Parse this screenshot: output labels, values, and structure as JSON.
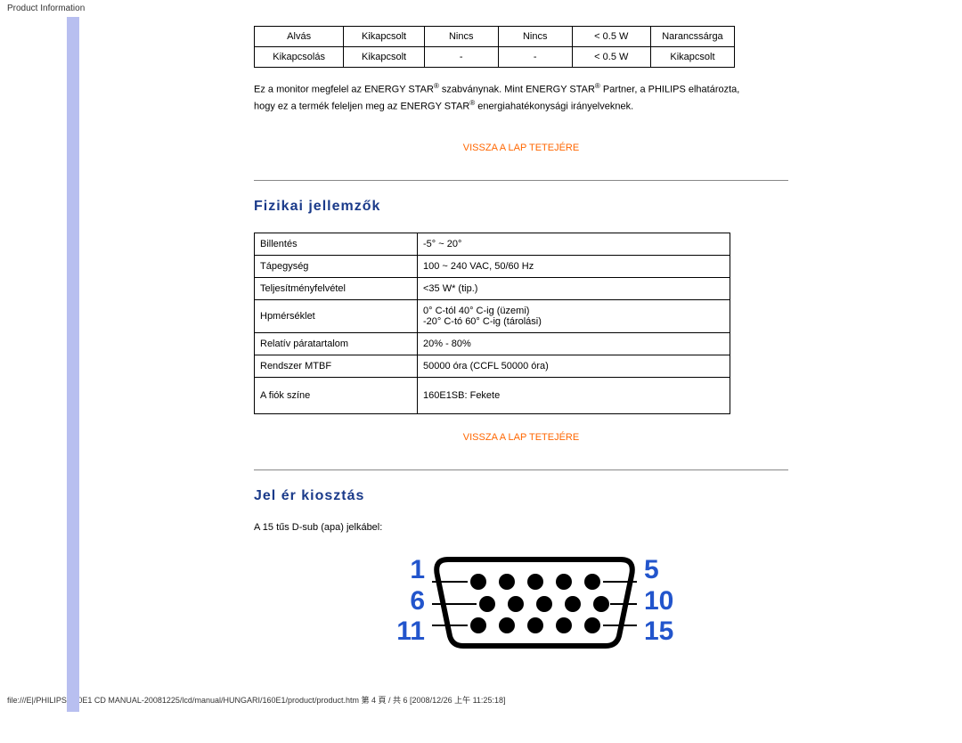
{
  "header": {
    "title": "Product Information"
  },
  "power_table": {
    "rows": [
      {
        "c1": "Alvás",
        "c2": "Kikapcsolt",
        "c3": "Nincs",
        "c4": "Nincs",
        "c5": "< 0.5 W",
        "c6": "Narancssárga"
      },
      {
        "c1": "Kikapcsolás",
        "c2": "Kikapcsolt",
        "c3": "-",
        "c4": "-",
        "c5": "< 0.5 W",
        "c6": "Kikapcsolt"
      }
    ]
  },
  "energy_text": {
    "line1a": "Ez a monitor megfelel az ENERGY STAR",
    "reg": "®",
    "line1b": " szabványnak. Mint ENERGY STAR",
    "line1c": " Partner, a PHILIPS elhatározta,",
    "line2a": "hogy ez a termék feleljen meg az ENERGY STAR",
    "line2b": " energiahatékonysági irányelveknek."
  },
  "back_top": "VISSZA A LAP TETEJÉRE",
  "sections": {
    "physical": "Fizikai jellemzők",
    "pin": "Jel ér kiosztás"
  },
  "spec_rows": [
    {
      "label": "Billentés",
      "value": "-5° ~ 20°"
    },
    {
      "label": "Tápegység",
      "value": "100 ~ 240 VAC, 50/60 Hz"
    },
    {
      "label": "Teljesítményfelvétel",
      "value": "<35 W* (tip.)"
    },
    {
      "label": "Hpmérséklet",
      "value": "0° C-tól 40° C-ig (üzemi)\n-20° C-tó 60° C-ig (tárolási)"
    },
    {
      "label": "Relatív páratartalom",
      "value": "20% - 80%"
    },
    {
      "label": "Rendszer MTBF",
      "value": "50000 óra (CCFL 50000 óra)"
    },
    {
      "label": "A fiók színe",
      "value": "160E1SB: Fekete"
    }
  ],
  "dsub_text": "A 15 tűs D-sub (apa) jelkábel:",
  "connector_numbers": {
    "left": [
      "1",
      "6",
      "11"
    ],
    "right": [
      "5",
      "10",
      "15"
    ]
  },
  "footer": "file:///E|/PHILIPS/160E1 CD MANUAL-20081225/lcd/manual/HUNGARI/160E1/product/product.htm 第 4 頁 / 共 6  [2008/12/26 上午 11:25:18]"
}
